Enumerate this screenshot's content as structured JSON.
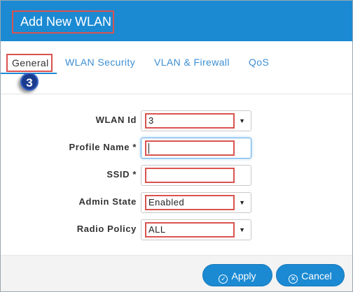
{
  "dialog": {
    "title": "Add New WLAN"
  },
  "tabs": [
    {
      "label": "General",
      "active": true
    },
    {
      "label": "WLAN Security",
      "active": false
    },
    {
      "label": "VLAN & Firewall",
      "active": false
    },
    {
      "label": "QoS",
      "active": false
    }
  ],
  "step_badge": "3",
  "form": {
    "wlan_id": {
      "label": "WLAN Id",
      "value": "3"
    },
    "profile_name": {
      "label": "Profile Name *",
      "value": ""
    },
    "ssid": {
      "label": "SSID *",
      "value": ""
    },
    "admin_state": {
      "label": "Admin State",
      "value": "Enabled"
    },
    "radio_policy": {
      "label": "Radio Policy",
      "value": "ALL"
    }
  },
  "buttons": {
    "apply": "Apply",
    "cancel": "Cancel"
  },
  "icons": {
    "apply": "check-circle-icon",
    "cancel": "x-circle-icon",
    "dropdown": "triangle-down-icon"
  },
  "colors": {
    "primary": "#1b8ad3",
    "highlight": "#d9534f",
    "badge": "#1a3c8f"
  }
}
